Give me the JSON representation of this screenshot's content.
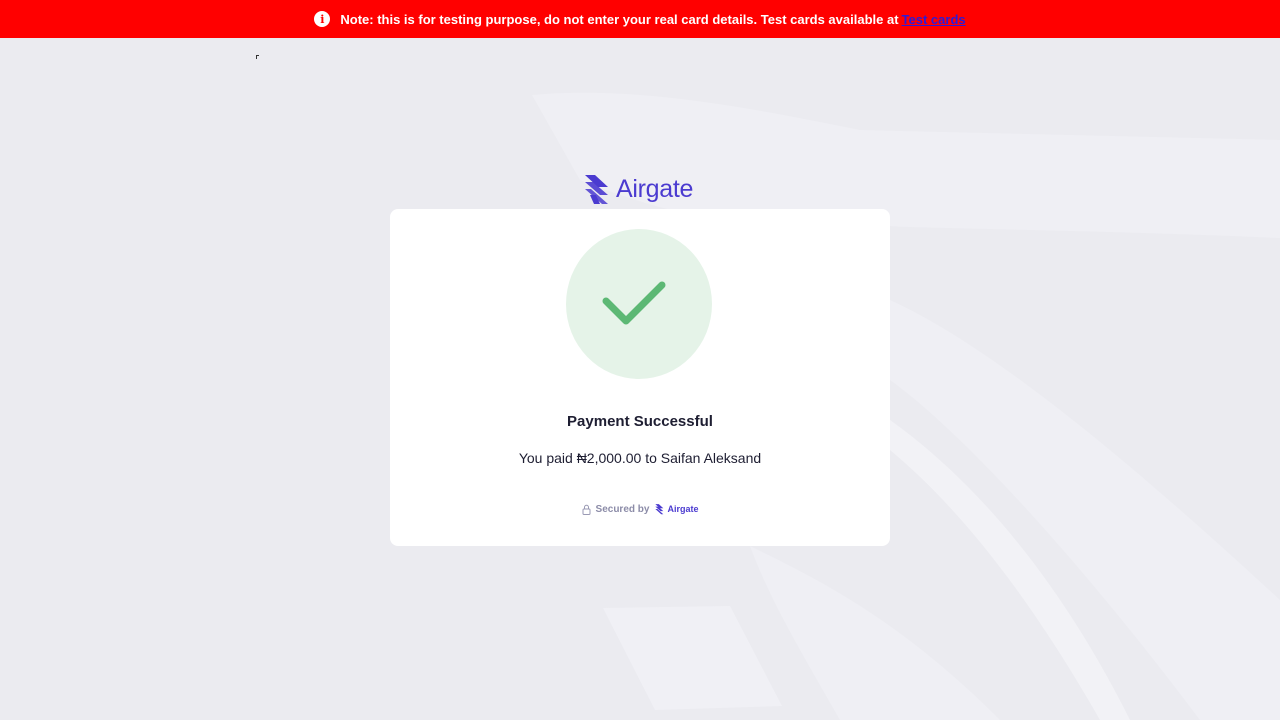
{
  "banner": {
    "icon": "info-icon",
    "message": "Note: this is for testing purpose, do not enter your real card details. Test cards available at",
    "link_label": "Test cards",
    "color": "#ff0000"
  },
  "brand": {
    "name": "Airgate",
    "color": "#4b3bd0"
  },
  "status": {
    "icon": "checkmark-icon",
    "title": "Payment Successful",
    "description": "You paid ₦2,000.00 to Saifan Aleksand",
    "success_color": "#5cb874"
  },
  "footer": {
    "secured_label": "Secured by",
    "brand_name": "Airgate"
  }
}
